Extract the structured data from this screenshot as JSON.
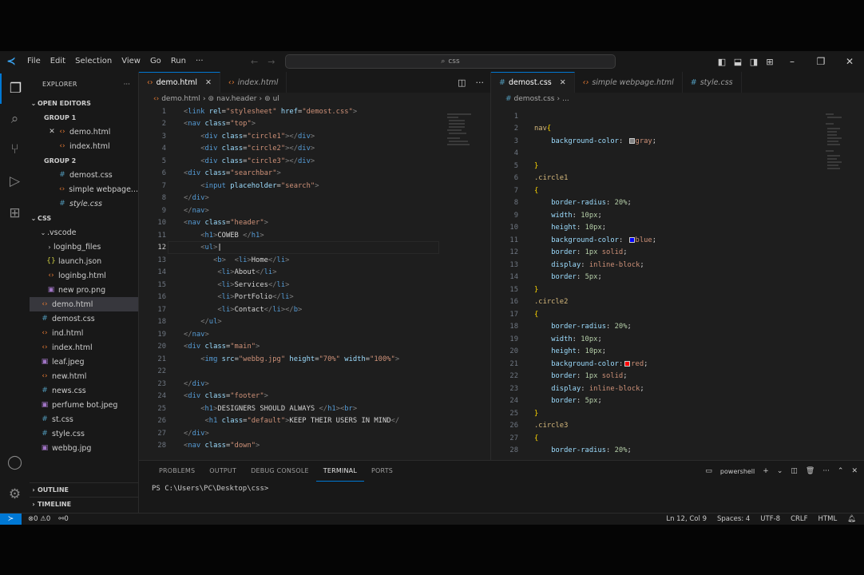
{
  "menu": [
    "File",
    "Edit",
    "Selection",
    "View",
    "Go",
    "Run",
    "···"
  ],
  "command_center": {
    "text": "css"
  },
  "sidebar": {
    "title": "EXPLORER",
    "open_editors": {
      "label": "OPEN EDITORS",
      "groups": [
        {
          "label": "GROUP 1",
          "files": [
            "demo.html",
            "index.html"
          ]
        },
        {
          "label": "GROUP 2",
          "files": [
            "demost.css",
            "simple webpage...",
            "style.css"
          ]
        }
      ]
    },
    "folder": {
      "label": "CSS",
      "items": [
        ".vscode",
        "loginbg_files",
        "launch.json",
        "loginbg.html",
        "new pro.png",
        "demo.html",
        "demost.css",
        "ind.html",
        "index.html",
        "leaf.jpeg",
        "new.html",
        "news.css",
        "perfume bot.jpeg",
        "st.css",
        "style.css",
        "webbg.jpg"
      ]
    },
    "outline": "OUTLINE",
    "timeline": "TIMELINE"
  },
  "left_editor": {
    "tabs": [
      "demo.html",
      "index.html"
    ],
    "breadcrumb": [
      "demo.html",
      "nav.header",
      "ul"
    ]
  },
  "right_editor": {
    "tabs": [
      "demost.css",
      "simple webpage.html",
      "style.css"
    ],
    "breadcrumb": [
      "demost.css",
      "..."
    ]
  },
  "panel": {
    "tabs": [
      "PROBLEMS",
      "OUTPUT",
      "DEBUG CONSOLE",
      "TERMINAL",
      "PORTS"
    ],
    "active_tab": "TERMINAL",
    "shell": "powershell",
    "prompt": "PS C:\\Users\\PC\\Desktop\\css>"
  },
  "status": {
    "errors": "0",
    "warnings": "0",
    "ports": "0",
    "position": "Ln 12, Col 9",
    "spaces": "Spaces: 4",
    "encoding": "UTF-8",
    "eol": "CRLF",
    "language": "HTML"
  },
  "colors": {
    "accent": "#0078d4",
    "background": "#1e1e1e",
    "sidebar": "#181818"
  }
}
